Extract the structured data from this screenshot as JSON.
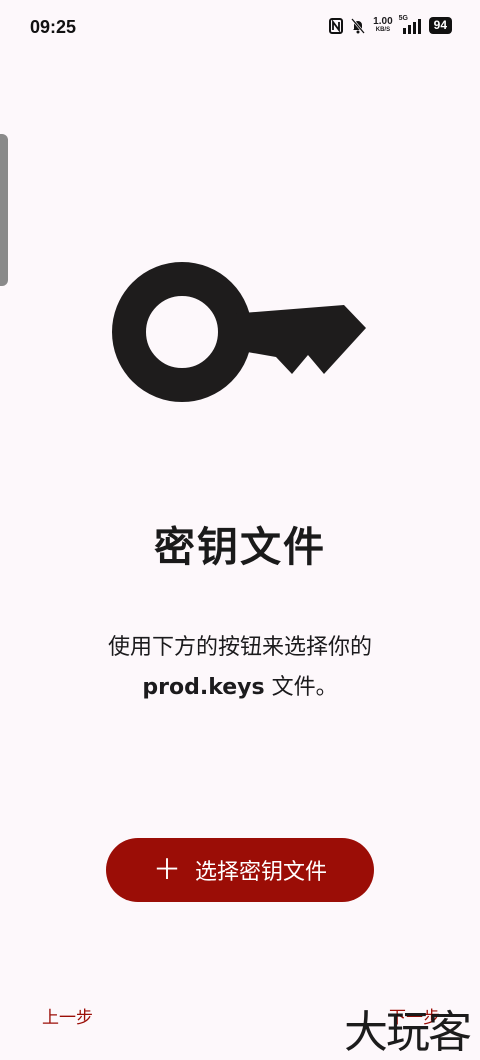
{
  "status_bar": {
    "time": "09:25",
    "net_speed_value": "1.00",
    "net_speed_unit": "KB/S",
    "network_type": "5G",
    "battery": "94",
    "icons": [
      "nfc-icon",
      "bell-muted-icon",
      "signal-icon"
    ]
  },
  "main": {
    "icon": "key-icon",
    "title": "密钥文件",
    "description_line1": "使用下方的按钮来选择你的",
    "description_file": "prod.keys",
    "description_line2_suffix": " 文件。",
    "select_button_icon": "＋",
    "select_button_label": "选择密钥文件"
  },
  "footer": {
    "prev_label": "上一步",
    "next_label": "下一步"
  },
  "watermark": "大玩客",
  "colors": {
    "background": "#fdf8fb",
    "accent": "#9b0d06",
    "text": "#1c1b1d"
  }
}
